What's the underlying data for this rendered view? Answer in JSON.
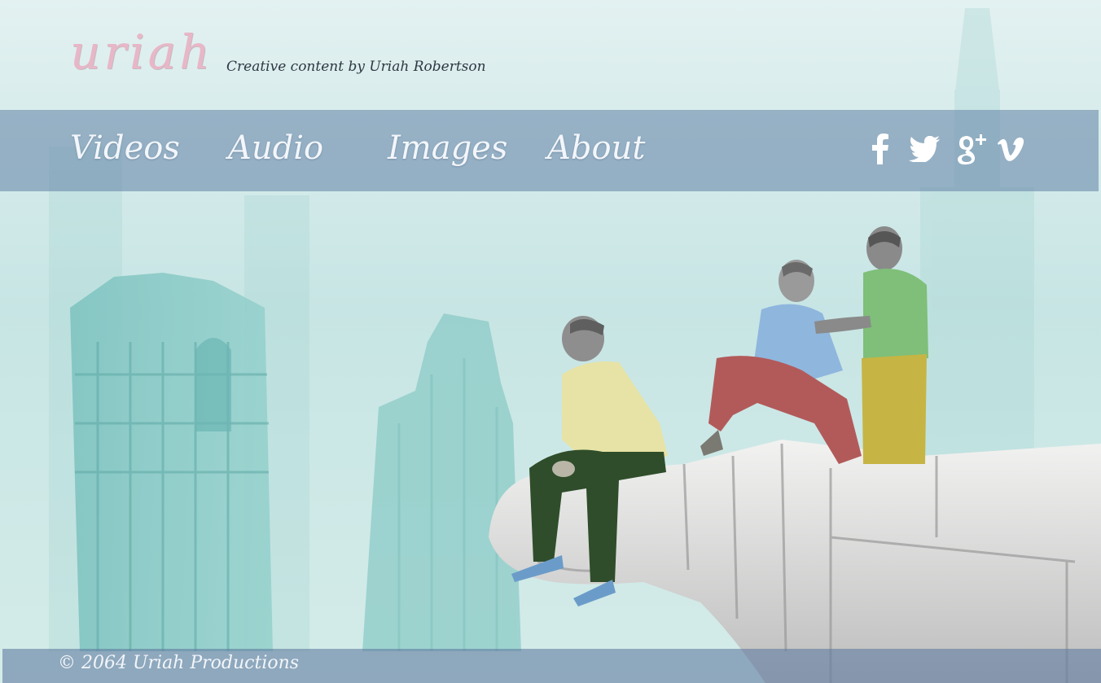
{
  "site": {
    "logo": "uriah",
    "tagline": "Creative content by Uriah Robertson"
  },
  "nav": {
    "items": [
      {
        "label": "Videos"
      },
      {
        "label": "Audio"
      },
      {
        "label": "Images"
      },
      {
        "label": "About"
      }
    ]
  },
  "social": [
    {
      "icon": "facebook-icon"
    },
    {
      "icon": "twitter-icon"
    },
    {
      "icon": "google-plus-icon"
    },
    {
      "icon": "vimeo-icon"
    }
  ],
  "footer": {
    "copyright": "© 2064 Uriah Productions"
  },
  "colors": {
    "logo": "#e8b7c7",
    "nav_bar": "#6e8cac",
    "background": "#cfe9e8",
    "text_light": "#f3f6fb"
  }
}
